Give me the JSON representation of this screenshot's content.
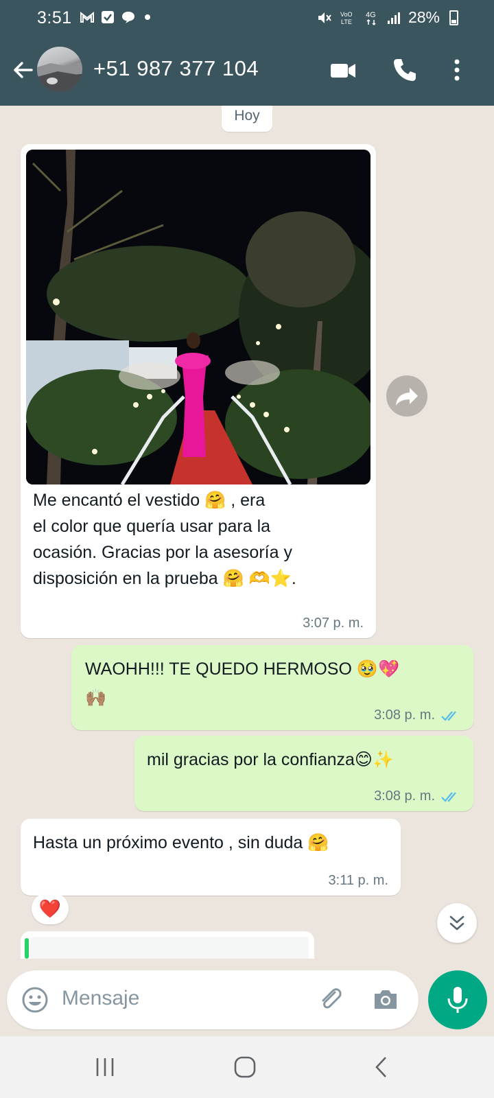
{
  "status_bar": {
    "time": "3:51",
    "battery": "28%",
    "network_label": "4G",
    "icons": [
      "gmail-icon",
      "check-box-icon",
      "chat-bubble-icon",
      "dot-icon",
      "mute-icon",
      "volte-icon",
      "signal-icon",
      "battery-icon"
    ]
  },
  "header": {
    "contact_name": "+51 987 377 104",
    "icons": [
      "back-arrow-icon",
      "video-call-icon",
      "phone-call-icon",
      "more-options-icon"
    ]
  },
  "chat": {
    "date_chip": "Hoy",
    "messages": [
      {
        "direction": "incoming",
        "has_photo": true,
        "lines": [
          "Me encantó el vestido 🤗 , era",
          "el color que quería usar para la",
          "ocasión. Gracias por la asesoría y",
          "disposición en la prueba 🤗 🫶⭐."
        ],
        "time": "3:07 p. m."
      },
      {
        "direction": "outgoing",
        "lines": [
          "WAOHH!!! TE QUEDO HERMOSO 🥹💖",
          "🙌🏽"
        ],
        "time": "3:08 p. m.",
        "status": "read"
      },
      {
        "direction": "outgoing",
        "lines": [
          "mil gracias por la confianza😊✨"
        ],
        "time": "3:08 p. m.",
        "status": "read"
      },
      {
        "direction": "incoming",
        "lines": [
          "Hasta un próximo evento , sin duda 🤗"
        ],
        "time": "3:11 p. m.",
        "reaction": "❤️"
      }
    ]
  },
  "input": {
    "placeholder": "Mensaje"
  },
  "colors": {
    "header_bg": "#3b555e",
    "chat_bg": "#ece5dd",
    "outgoing_bubble": "#dcf8c6",
    "incoming_bubble": "#ffffff",
    "read_ticks": "#53bdeb",
    "mic_button": "#00a884"
  }
}
